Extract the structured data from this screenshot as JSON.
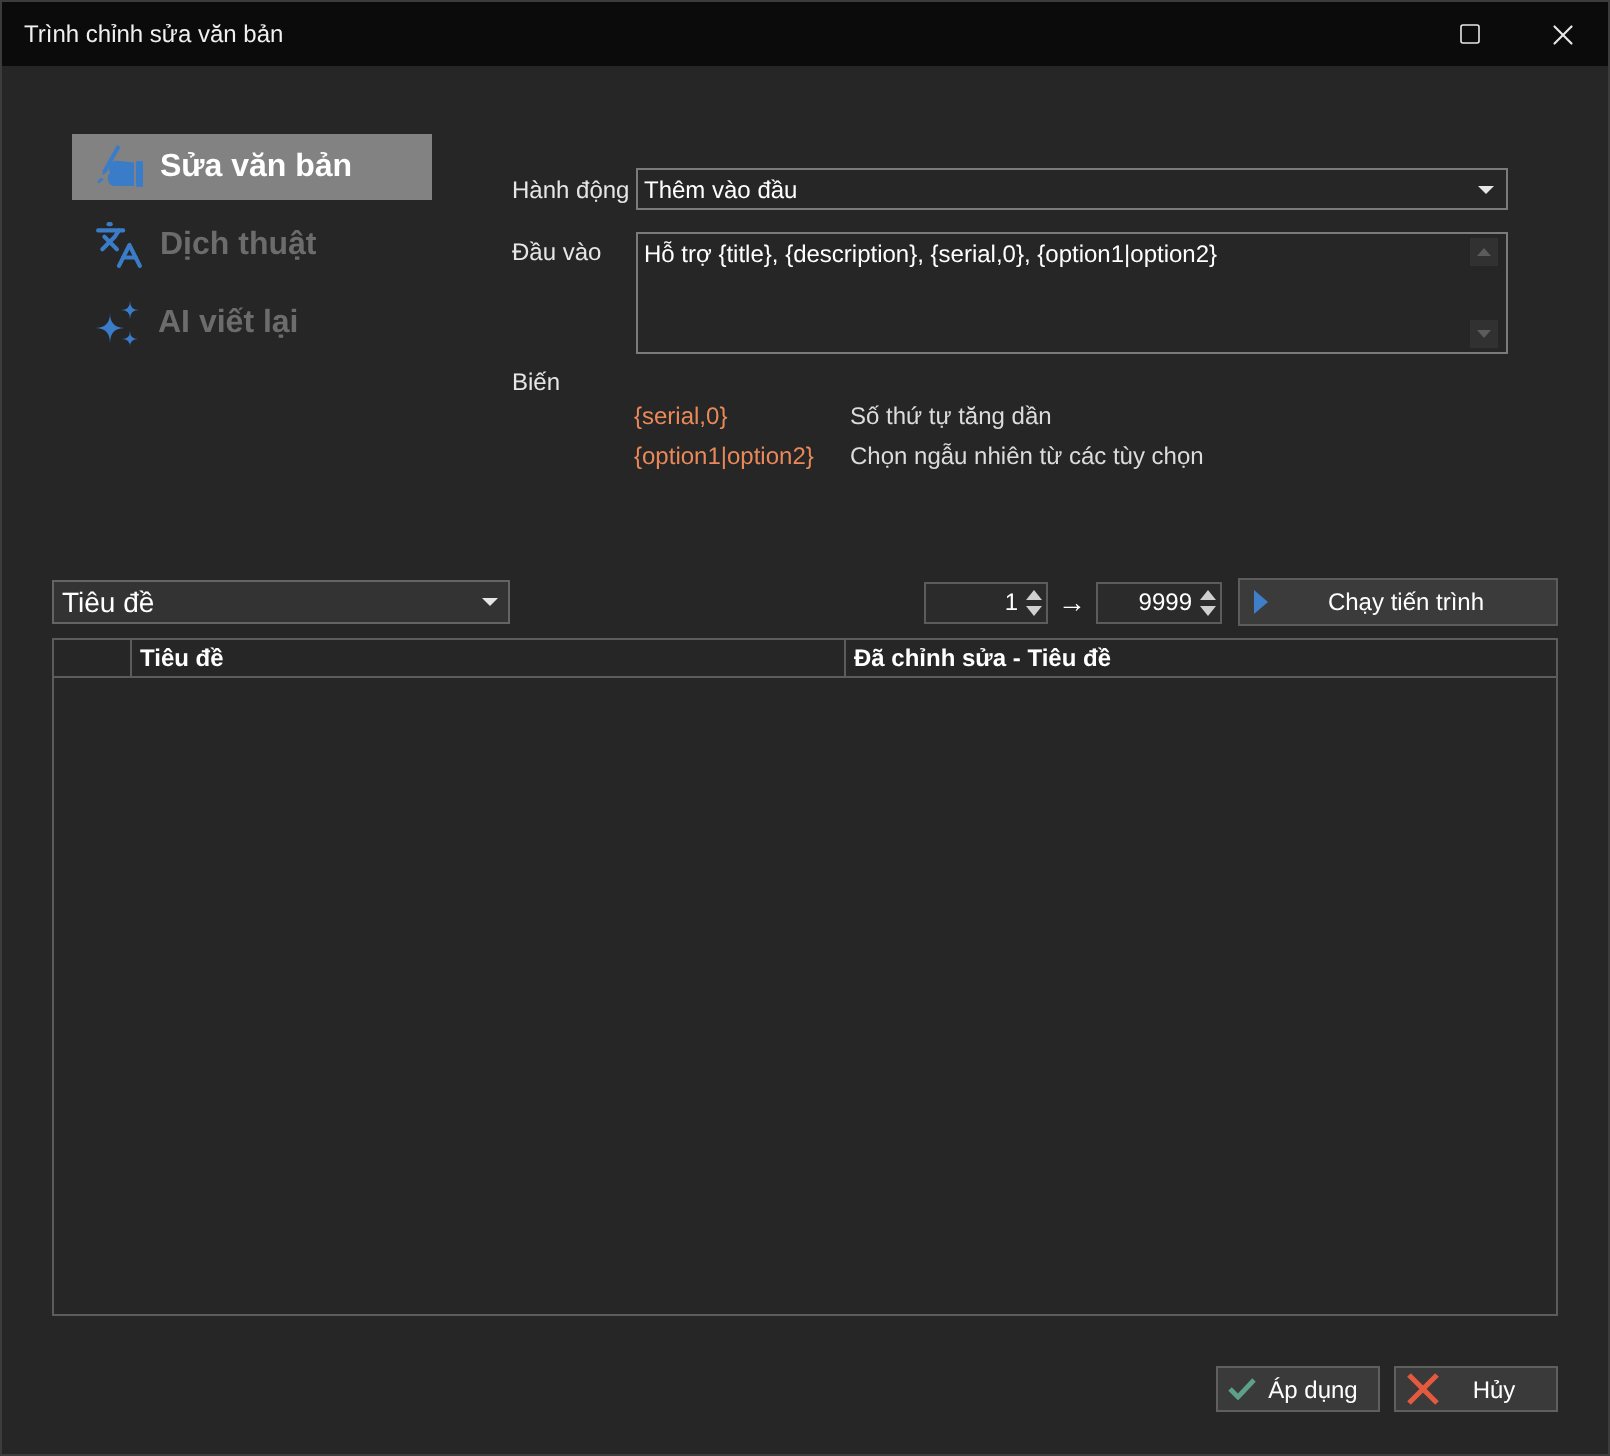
{
  "window": {
    "title": "Trình chỉnh sửa văn bản"
  },
  "sidebar": {
    "items": [
      {
        "kind": "edit",
        "label": "Sửa văn bản",
        "selected": true
      },
      {
        "kind": "translate",
        "label": "Dịch thuật",
        "selected": false
      },
      {
        "kind": "rewrite",
        "label": "AI viết lại",
        "selected": false
      }
    ]
  },
  "form": {
    "action": {
      "label": "Hành động",
      "value": "Thêm vào đầu"
    },
    "input": {
      "label": "Đầu vào",
      "value": "Hỗ trợ {title}, {description}, {serial,0}, {option1|option2}"
    },
    "variables": {
      "label": "Biến",
      "items": [
        {
          "token": "{serial,0}",
          "description": "Số thứ tự tăng dần"
        },
        {
          "token": "{option1|option2}",
          "description": "Chọn ngẫu nhiên từ các tùy chọn"
        }
      ]
    }
  },
  "toolbar": {
    "column_select": {
      "value": "Tiêu đề"
    },
    "range": {
      "from": "1",
      "arrow": "→",
      "to": "9999"
    },
    "run_button": {
      "label": "Chạy tiến trình"
    }
  },
  "table": {
    "columns": [
      {
        "label": "Tiêu đề"
      },
      {
        "label": "Đã chỉnh sửa - Tiêu đề"
      }
    ]
  },
  "footer": {
    "buttons": [
      {
        "kind": "apply",
        "label": "Áp dụng"
      },
      {
        "kind": "cancel",
        "label": "Hủy"
      }
    ]
  }
}
